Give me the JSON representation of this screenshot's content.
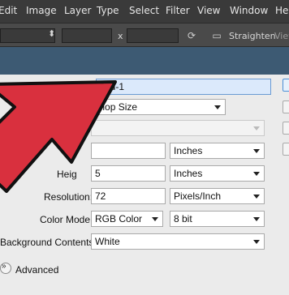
{
  "menubar": {
    "items": [
      "Edit",
      "Image",
      "Layer",
      "Type",
      "Select",
      "Filter",
      "View",
      "Window",
      "Hel"
    ]
  },
  "optionsbar": {
    "multiply": "x",
    "straighten": "Straighten",
    "view": "View"
  },
  "dialog": {
    "name_value": "tled-1",
    "preset_value": "Photoshop Size",
    "width_unit": "Inches",
    "height_label": "Heig",
    "height_value": "5",
    "height_unit": "Inches",
    "resolution_label": "Resolution:",
    "resolution_value": "72",
    "resolution_unit": "Pixels/Inch",
    "color_mode_label": "Color Mode:",
    "color_mode_value": "RGB Color",
    "bit_depth_value": "8 bit",
    "background_label": "Background Contents:",
    "background_value": "White",
    "advanced_label": "Advanced"
  },
  "colors": {
    "arrow_red": "#d9303e",
    "arrow_outline": "#111111",
    "menubar_bg": "#3a3a3a",
    "header_blue": "#3d5a73"
  },
  "icons": [
    "red-arrow-overlay",
    "rotate-icon",
    "straighten-icon",
    "advanced-expand-icon"
  ]
}
